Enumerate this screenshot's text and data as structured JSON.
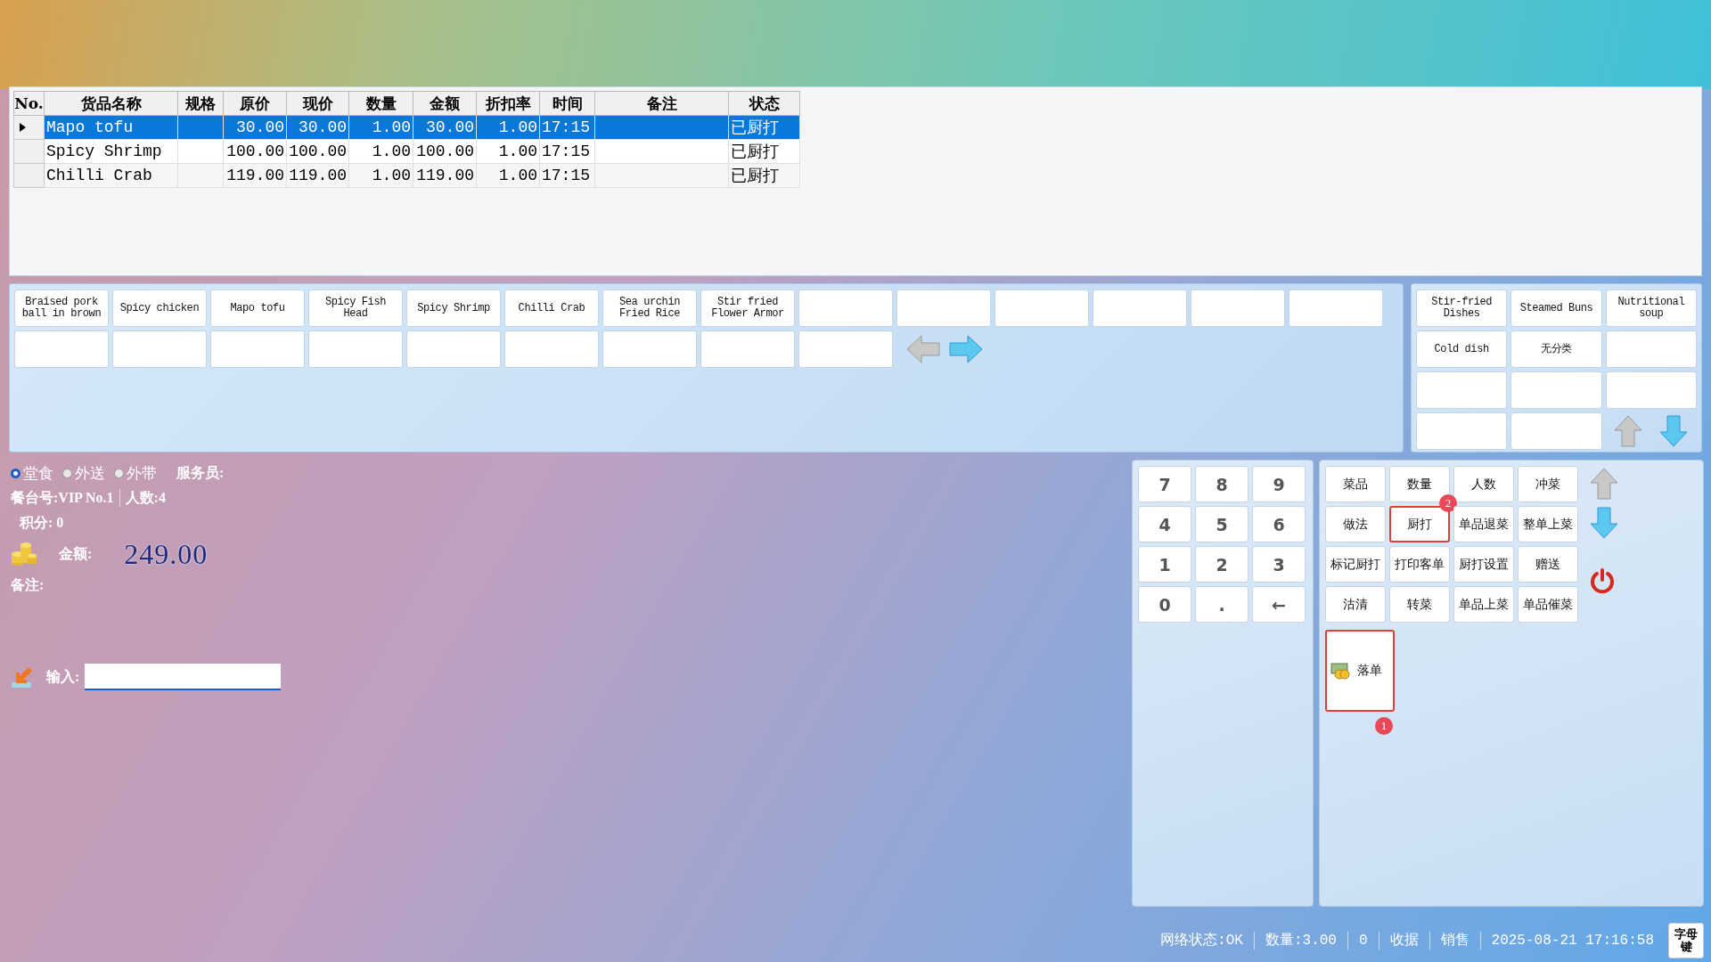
{
  "table": {
    "columns": [
      "No.",
      "货品名称",
      "规格",
      "原价",
      "现价",
      "数量",
      "金额",
      "折扣率",
      "时间",
      "备注",
      "状态"
    ],
    "rows": [
      {
        "selected": true,
        "cells": [
          "",
          "Mapo tofu",
          "",
          "30.00",
          "30.00",
          "1.00",
          "30.00",
          "1.00",
          "17:15",
          "",
          "已厨打"
        ]
      },
      {
        "selected": false,
        "cells": [
          "",
          "Spicy Shrimp",
          "",
          "100.00",
          "100.00",
          "1.00",
          "100.00",
          "1.00",
          "17:15",
          "",
          "已厨打"
        ]
      },
      {
        "selected": false,
        "cells": [
          "",
          "Chilli Crab",
          "",
          "119.00",
          "119.00",
          "1.00",
          "119.00",
          "1.00",
          "17:15",
          "",
          "已厨打"
        ]
      }
    ]
  },
  "dish_buttons": [
    "Braised pork ball in brown",
    "Spicy chicken",
    "Mapo tofu",
    "Spicy Fish Head",
    "Spicy Shrimp",
    "Chilli Crab",
    "Sea urchin Fried Rice",
    "Stir fried Flower Armor"
  ],
  "category_buttons": [
    "Stir-fried Dishes",
    "Steamed Buns",
    "Nutritional soup",
    "Cold dish",
    "无分类"
  ],
  "order_info": {
    "dining_modes": [
      {
        "label": "堂食",
        "selected": true
      },
      {
        "label": "外送",
        "selected": false
      },
      {
        "label": "外带",
        "selected": false
      }
    ],
    "waiter": "服务员:",
    "table_no": "餐台号:VIP No.1",
    "guests": "人数:4",
    "points": "积分: 0",
    "amount_label": "金额:",
    "amount": "249.00",
    "remark": "备注:",
    "input_label": "输入:"
  },
  "keypad": [
    "7",
    "8",
    "9",
    "4",
    "5",
    "6",
    "1",
    "2",
    "3",
    "0",
    ".",
    "←"
  ],
  "function_buttons": [
    {
      "label": "菜品",
      "highlighted": false
    },
    {
      "label": "数量",
      "highlighted": false
    },
    {
      "label": "人数",
      "highlighted": false
    },
    {
      "label": "冲菜",
      "highlighted": false
    },
    {
      "label": "做法",
      "highlighted": false
    },
    {
      "label": "厨打",
      "highlighted": true,
      "badge": "2"
    },
    {
      "label": "单品退菜",
      "highlighted": false
    },
    {
      "label": "整单上菜",
      "highlighted": false
    },
    {
      "label": "标记厨打",
      "highlighted": false
    },
    {
      "label": "打印客单",
      "highlighted": false
    },
    {
      "label": "厨打设置",
      "highlighted": false
    },
    {
      "label": "赠送",
      "highlighted": false
    },
    {
      "label": "沽清",
      "highlighted": false
    },
    {
      "label": "转菜",
      "highlighted": false
    },
    {
      "label": "单品上菜",
      "highlighted": false
    },
    {
      "label": "单品催菜",
      "highlighted": false
    }
  ],
  "submit_button": {
    "label": "落单",
    "highlighted": true,
    "badge": "1"
  },
  "status_bar": {
    "items": [
      "网络状态:OK",
      "数量:3.00",
      "0",
      "收据",
      "销售",
      "2025-08-21 17:16:58"
    ],
    "keyboard_button": "字母键"
  }
}
